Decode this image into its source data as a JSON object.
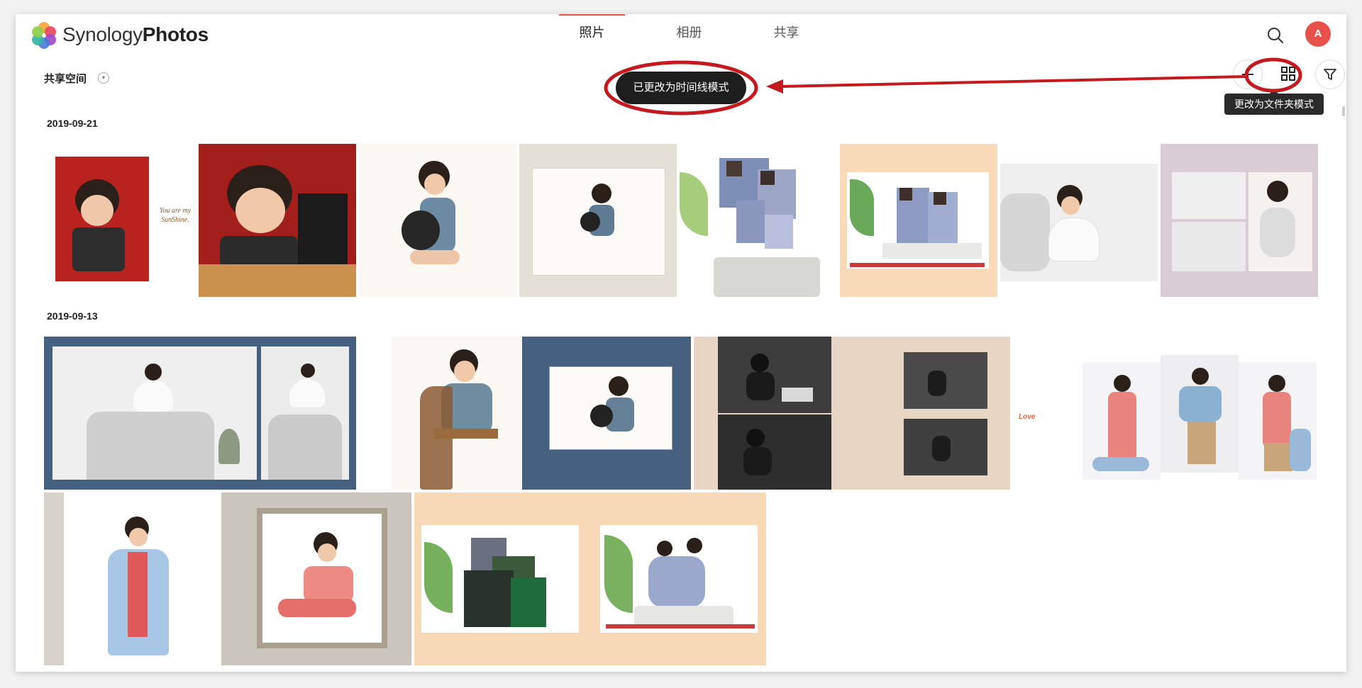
{
  "app": {
    "name_light": "Synology",
    "name_bold": "Photos"
  },
  "nav": {
    "tabs": [
      {
        "label": "照片",
        "active": true
      },
      {
        "label": "相册",
        "active": false
      },
      {
        "label": "共享",
        "active": false
      }
    ],
    "avatar_letter": "A"
  },
  "toolbar": {
    "space_label": "共享空间",
    "toast": "已更改为时间线模式",
    "tooltip": "更改为文件夹模式"
  },
  "groups": [
    {
      "date": "2019-09-21"
    },
    {
      "date": "2019-09-13"
    }
  ],
  "photo_texts": {
    "caption_line1": "You are my",
    "caption_line2": "SunShine.",
    "love": "Love"
  },
  "colors": {
    "accent": "#e4564d",
    "annotation": "#c41a1f",
    "toast_bg": "#1e1e1e"
  },
  "icons": [
    "logo-icon",
    "search-icon",
    "plus-icon",
    "grid-icon",
    "filter-icon",
    "chevron-down-icon"
  ]
}
